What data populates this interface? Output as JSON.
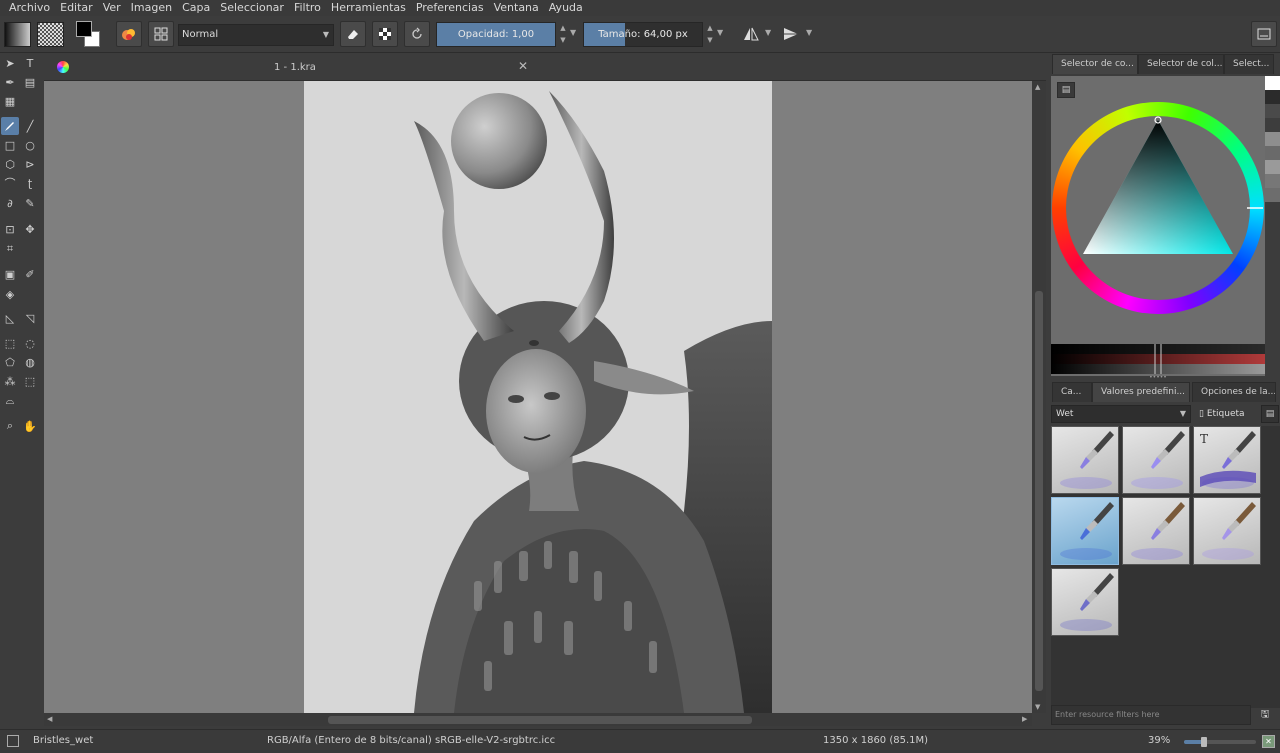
{
  "menu": [
    "Archivo",
    "Editar",
    "Ver",
    "Imagen",
    "Capa",
    "Seleccionar",
    "Filtro",
    "Herramientas",
    "Preferencias",
    "Ventana",
    "Ayuda"
  ],
  "toolbar": {
    "blend_mode": "Normal",
    "opacity_label": "Opacidad:",
    "opacity_value": "1,00",
    "opacity_fraction": 1.0,
    "size_label": "Tamaño:",
    "size_value": "64,00 px",
    "size_fraction": 0.35
  },
  "document": {
    "tab_title": "1 - 1.kra"
  },
  "dock": {
    "top_tabs": [
      "Selector de co...",
      "Selector de col...",
      "Select..."
    ],
    "history_colors": [
      "#ffffff",
      "#2b2b2b",
      "#4a4a4a",
      "#3d3d3d",
      "#8e8e8e",
      "#6a6a6a",
      "#9a9a9a",
      "#777777",
      "#6d6d6d"
    ],
    "preset_tabs": [
      "Ca...",
      "Valores predefini...",
      "Opciones de la..."
    ],
    "tag": "Wet",
    "tag_filter": "Etiqueta",
    "resource_filter_placeholder": "Enter resource filters here",
    "presets_count_shown": 7
  },
  "status": {
    "preset_name": "Bristles_wet",
    "color_model": "RGB/Alfa (Entero de 8 bits/canal)  sRGB-elle-V2-srgbtrc.icc",
    "dimensions": "1350 x 1860 (85.1M)",
    "zoom": "39%",
    "zoom_fraction": 0.28
  },
  "colors": {
    "accent": "#5b7fa6",
    "canvas_bg": "#7f7f7f",
    "paper": "#d7d7d7"
  }
}
